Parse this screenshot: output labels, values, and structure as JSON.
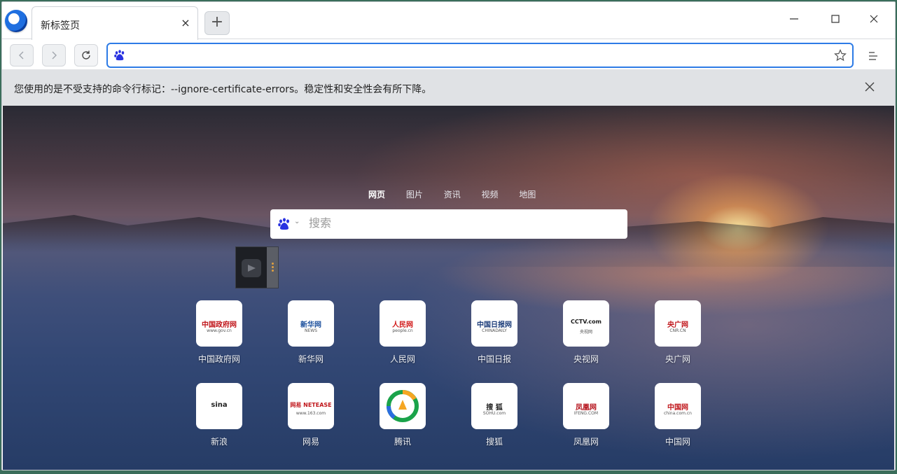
{
  "tab": {
    "title": "新标签页",
    "close_glyph": "×"
  },
  "newtab": {
    "glyph": "+"
  },
  "window_controls": {
    "minimize": "─",
    "maximize": "☐",
    "close": "✕"
  },
  "toolbar": {
    "back": "‹",
    "forward": "›",
    "reload": "⟳",
    "address_value": "",
    "search_engine_icon": "baidu-paw-icon",
    "accent": "#2d7be6"
  },
  "infobar": {
    "message": "您使用的是不受支持的命令行标记：--ignore-certificate-errors。稳定性和安全性会有所下降。"
  },
  "search": {
    "tabs": [
      "网页",
      "图片",
      "资讯",
      "视频",
      "地图"
    ],
    "active_tab": "网页",
    "placeholder": "搜索",
    "caret": "⌄"
  },
  "shortcuts": [
    {
      "label": "中国政府网",
      "icon_text": "中国政府网",
      "icon_sub": "www.gov.cn",
      "color": "#c0161b"
    },
    {
      "label": "新华网",
      "icon_text": "新华网",
      "icon_sub": "NEWS",
      "color": "#1b4f9c"
    },
    {
      "label": "人民网",
      "icon_text": "人民网",
      "icon_sub": "people.cn",
      "color": "#d11a1a"
    },
    {
      "label": "中国日报",
      "icon_text": "中国日报网",
      "icon_sub": "CHINADAILY",
      "color": "#1c3d7a"
    },
    {
      "label": "央视网",
      "icon_text": "CCTV.com",
      "icon_sub": "央视网",
      "color": "#1a1a1a"
    },
    {
      "label": "央广网",
      "icon_text": "央广网",
      "icon_sub": "CNR.CN",
      "color": "#c0161b"
    },
    {
      "label": "新浪",
      "icon_text": "sina",
      "icon_sub": "",
      "color": "#222222"
    },
    {
      "label": "网易",
      "icon_text": "网易 NETEASE",
      "icon_sub": "www.163.com",
      "color": "#c0161b"
    },
    {
      "label": "腾讯",
      "icon_text": "",
      "icon_sub": "",
      "color": "#1aa34a"
    },
    {
      "label": "搜狐",
      "icon_text": "搜 狐",
      "icon_sub": "SOHU.com",
      "color": "#222222"
    },
    {
      "label": "凤凰网",
      "icon_text": "凤凰网",
      "icon_sub": "IFENG.COM",
      "color": "#b5121b"
    },
    {
      "label": "中国网",
      "icon_text": "中国网",
      "icon_sub": "china.com.cn",
      "color": "#c0161b"
    }
  ]
}
